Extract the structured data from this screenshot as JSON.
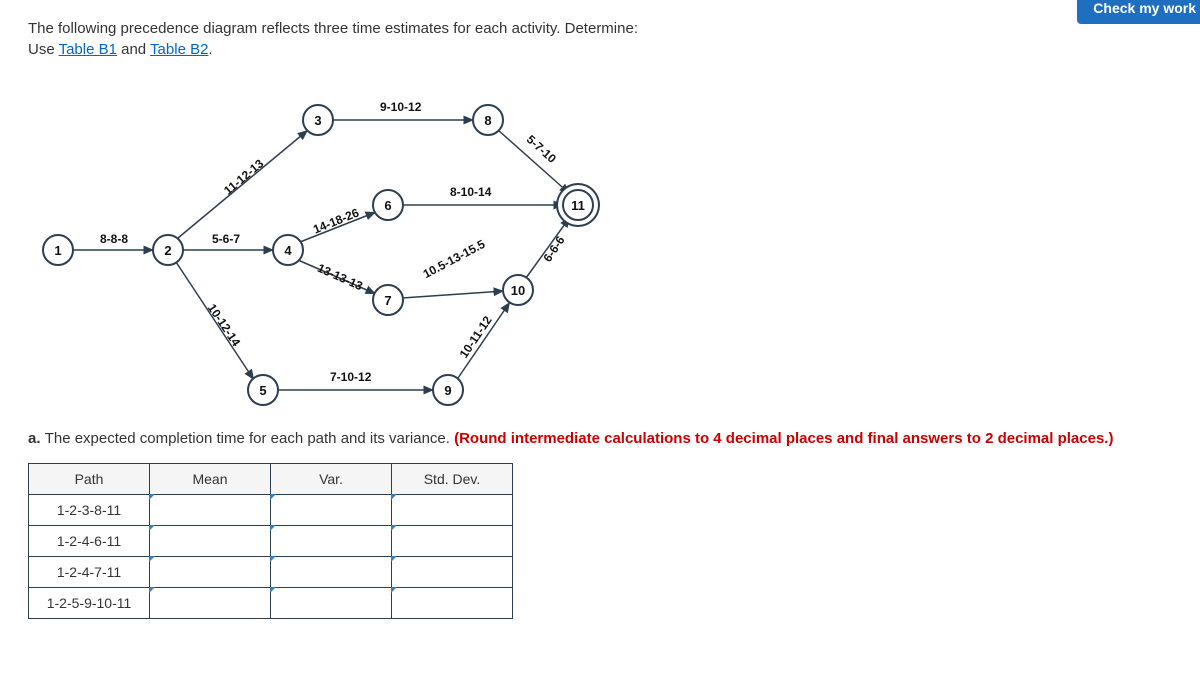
{
  "header": {
    "button": "Check my work"
  },
  "instructions": {
    "line1": "The following precedence diagram reflects three time estimates for each activity. Determine:",
    "line2_prefix": "Use ",
    "link1": "Table B1",
    "and": " and ",
    "link2": "Table B2",
    "period": "."
  },
  "nodes": {
    "n1": "1",
    "n2": "2",
    "n3": "3",
    "n4": "4",
    "n5": "5",
    "n6": "6",
    "n7": "7",
    "n8": "8",
    "n9": "9",
    "n10": "10",
    "n11": "11"
  },
  "edges": {
    "e12": "8-8-8",
    "e23": "11-12-13",
    "e24": "5-6-7",
    "e25": "10-12-14",
    "e38": "9-10-12",
    "e46": "14-18-26",
    "e47": "13-13-13",
    "e59": "7-10-12",
    "e611": "8-10-14",
    "e710": "10.5-13-15.5",
    "e811": "5-7-10",
    "e910": "10-11-12",
    "e1011": "6-6-6"
  },
  "question": {
    "prefix": "a. ",
    "text": "The expected completion time for each path and its variance. ",
    "note": "(Round intermediate calculations to 4 decimal places and final answers to 2 decimal places.)"
  },
  "table": {
    "headers": {
      "path": "Path",
      "mean": "Mean",
      "var": "Var.",
      "std": "Std. Dev."
    },
    "rows": [
      {
        "path": "1-2-3-8-11"
      },
      {
        "path": "1-2-4-6-11"
      },
      {
        "path": "1-2-4-7-11"
      },
      {
        "path": "1-2-5-9-10-11"
      }
    ]
  }
}
